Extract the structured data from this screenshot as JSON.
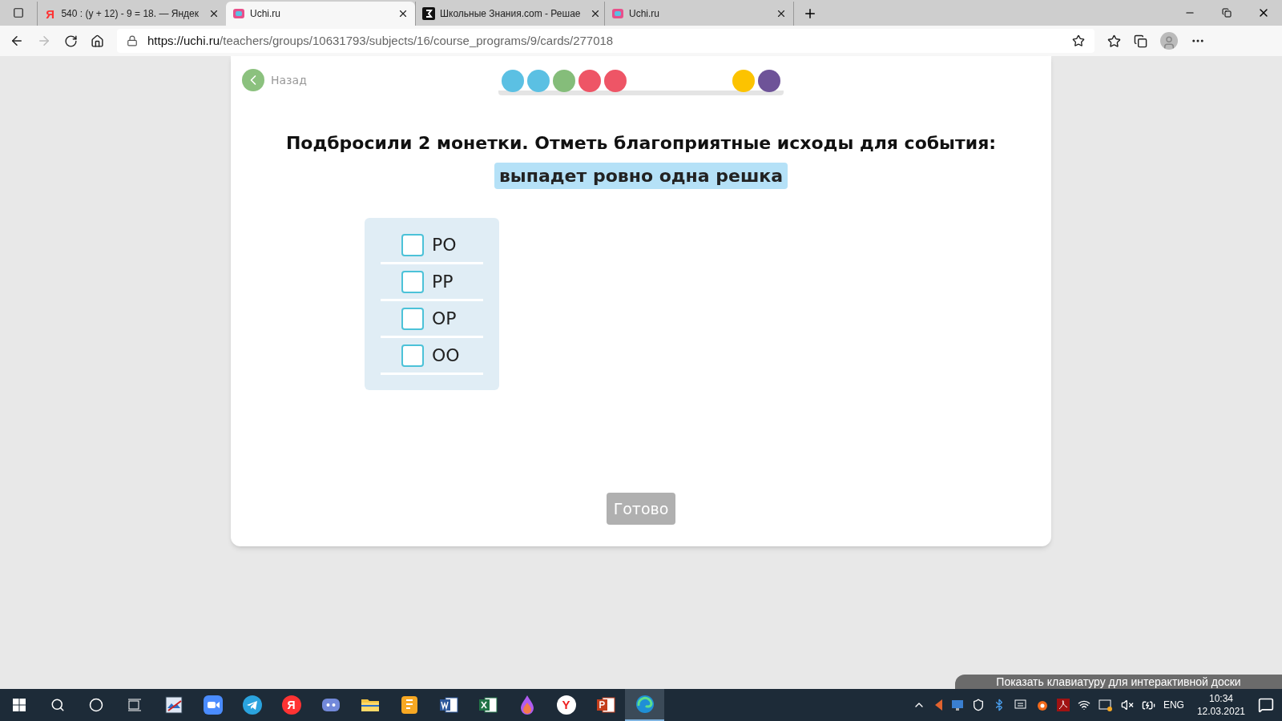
{
  "browser": {
    "tabs": [
      {
        "title": "540 : (y + 12) - 9 = 18. — Яндек",
        "kind": "yandex",
        "icon_text": "Я",
        "selected": false
      },
      {
        "title": "Uchi.ru",
        "kind": "uchi",
        "selected": true
      },
      {
        "title": "Школьные Знания.com - Решае",
        "kind": "znania",
        "selected": false
      },
      {
        "title": "Uchi.ru",
        "kind": "uchi",
        "selected": false
      }
    ],
    "url_host": "https://uchi.ru",
    "url_path": "/teachers/groups/10631793/subjects/16/course_programs/9/cards/277018"
  },
  "card": {
    "back_label": "Назад",
    "progress": [
      {
        "kind": "done",
        "color": "#5bc0e3"
      },
      {
        "kind": "done",
        "color": "#5bc0e3"
      },
      {
        "kind": "done",
        "color": "#85bd7a"
      },
      {
        "kind": "done",
        "color": "#ee5566"
      },
      {
        "kind": "done",
        "color": "#ee5566"
      },
      {
        "kind": "empty"
      },
      {
        "kind": "empty"
      },
      {
        "kind": "empty"
      },
      {
        "kind": "empty"
      },
      {
        "kind": "done",
        "color": "#fcc300"
      },
      {
        "kind": "done",
        "color": "#6e5398"
      }
    ],
    "question": "Подбросили 2 монетки. Отметь благоприятные исходы для события:",
    "event": "выпадет ровно одна решка",
    "options": [
      {
        "label": "РО",
        "checked": false
      },
      {
        "label": "РР",
        "checked": false
      },
      {
        "label": "ОР",
        "checked": false
      },
      {
        "label": "ОО",
        "checked": false
      }
    ],
    "submit": {
      "label": "Готово",
      "disabled": true
    }
  },
  "keyboard_hint": "Показать клавиатуру для интерактивной доски",
  "taskbar": {
    "apps": [
      {
        "kind": "photo",
        "selected": false
      },
      {
        "kind": "zoom",
        "selected": false
      },
      {
        "kind": "telegram",
        "selected": false
      },
      {
        "kind": "yandex",
        "icon_text": "Я",
        "selected": false
      },
      {
        "kind": "discord",
        "selected": false
      },
      {
        "kind": "folder",
        "selected": false
      },
      {
        "kind": "notes",
        "selected": false
      },
      {
        "kind": "word",
        "selected": false
      },
      {
        "kind": "excel",
        "selected": false
      },
      {
        "kind": "drop",
        "selected": false
      },
      {
        "kind": "ybrowser",
        "icon_text": "Y",
        "selected": false
      },
      {
        "kind": "powerpoint",
        "selected": false
      },
      {
        "kind": "edge",
        "selected": true
      }
    ],
    "language": "ENG",
    "time": "10:34",
    "date": "12.03.2021"
  }
}
